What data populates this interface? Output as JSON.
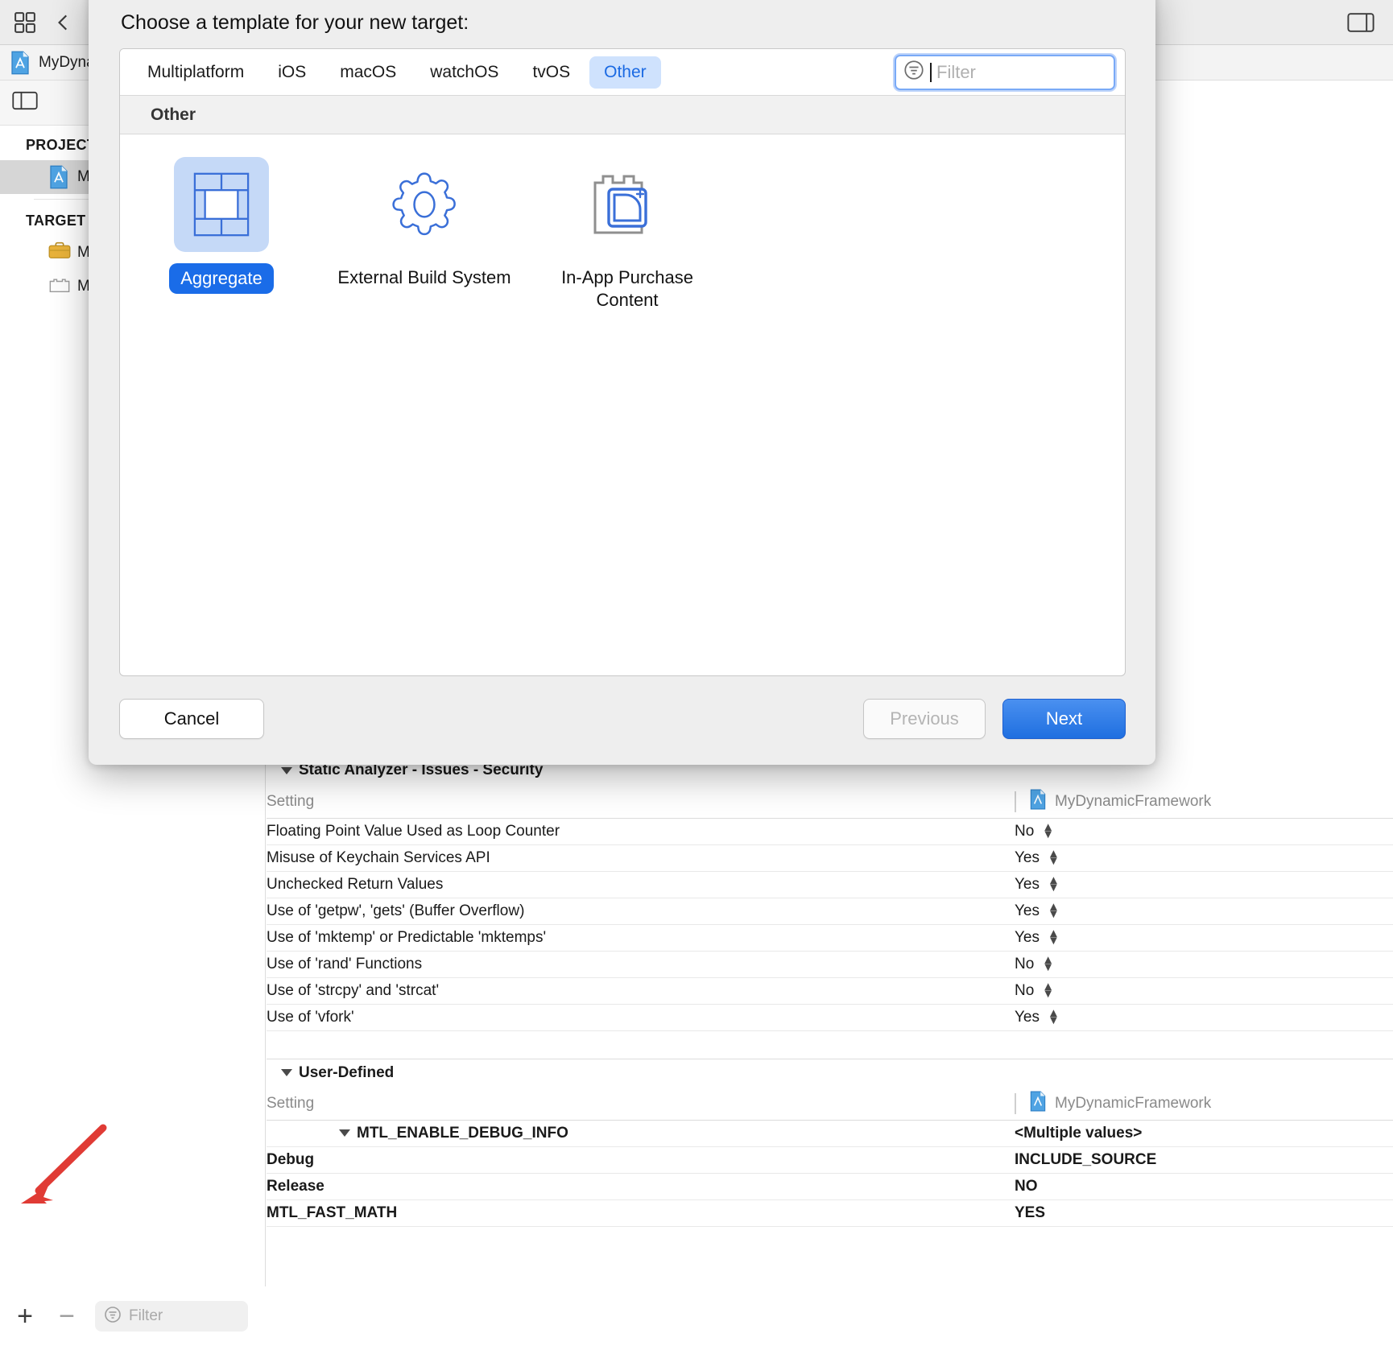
{
  "window": {
    "breadcrumb": "MyDynamicFramework",
    "project_icon": "xcode-project-icon"
  },
  "sidebar": {
    "project_group_label": "PROJECT",
    "target_group_label": "TARGET",
    "project_items": [
      {
        "label": "MyDynamicFramework",
        "icon": "xcode-project-icon",
        "selected": true
      }
    ],
    "target_items": [
      {
        "label": "MyDynamicFramework",
        "icon": "briefcase-icon"
      },
      {
        "label": "MyDynamicFrameworkTests",
        "icon": "test-bundle-icon"
      }
    ],
    "footer": {
      "add_label": "+",
      "remove_label": "−",
      "filter_placeholder": "Filter",
      "filter_icon": "filter-icon"
    }
  },
  "dialog": {
    "title": "Choose a template for your new target:",
    "tabs": [
      {
        "label": "Multiplatform",
        "active": false
      },
      {
        "label": "iOS",
        "active": false
      },
      {
        "label": "macOS",
        "active": false
      },
      {
        "label": "watchOS",
        "active": false
      },
      {
        "label": "tvOS",
        "active": false
      },
      {
        "label": "Other",
        "active": true
      }
    ],
    "filter": {
      "placeholder": "Filter",
      "value": "",
      "icon": "filter-icon",
      "focused": true
    },
    "section_header": "Other",
    "templates": [
      {
        "label": "Aggregate",
        "icon": "aggregate-icon",
        "selected": true
      },
      {
        "label": "External Build System",
        "icon": "gear-icon",
        "selected": false
      },
      {
        "label": "In-App Purchase Content",
        "icon": "in-app-purchase-icon",
        "selected": false
      }
    ],
    "buttons": {
      "cancel": "Cancel",
      "previous": "Previous",
      "next": "Next"
    }
  },
  "build_settings": {
    "sections": [
      {
        "title": "Static Analyzer - Issues - Security",
        "columns": [
          "Setting",
          "MyDynamicFramework"
        ],
        "rows": [
          {
            "setting": "Floating Point Value Used as Loop Counter",
            "value": "No",
            "stepper": true
          },
          {
            "setting": "Misuse of Keychain Services API",
            "value": "Yes",
            "stepper": true
          },
          {
            "setting": "Unchecked Return Values",
            "value": "Yes",
            "stepper": true
          },
          {
            "setting": "Use of 'getpw', 'gets' (Buffer Overflow)",
            "value": "Yes",
            "stepper": true
          },
          {
            "setting": "Use of 'mktemp' or Predictable 'mktemps'",
            "value": "Yes",
            "stepper": true
          },
          {
            "setting": "Use of 'rand' Functions",
            "value": "No",
            "stepper": true
          },
          {
            "setting": "Use of 'strcpy' and 'strcat'",
            "value": "No",
            "stepper": true
          },
          {
            "setting": "Use of 'vfork'",
            "value": "Yes",
            "stepper": true
          }
        ]
      },
      {
        "title": "User-Defined",
        "columns": [
          "Setting",
          "MyDynamicFramework"
        ],
        "rows": [
          {
            "setting": "MTL_ENABLE_DEBUG_INFO",
            "value": "<Multiple values>",
            "bold": true,
            "expanded": true,
            "muted_value": true
          },
          {
            "setting": "Debug",
            "value": "INCLUDE_SOURCE",
            "bold": true,
            "indent": 1
          },
          {
            "setting": "Release",
            "value": "NO",
            "bold": true,
            "indent": 1
          },
          {
            "setting": "MTL_FAST_MATH",
            "value": "YES",
            "bold": true
          }
        ]
      }
    ]
  },
  "annotation": {
    "arrow_color": "#e03b35",
    "points_to": "add-target-button"
  }
}
